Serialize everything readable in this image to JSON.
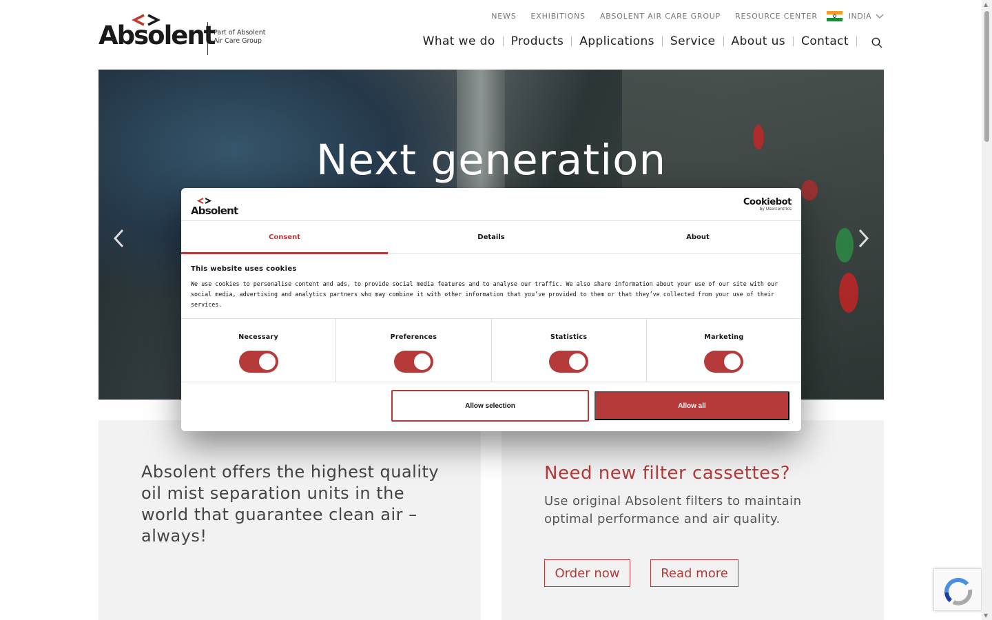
{
  "logo": {
    "word": "Absolent",
    "sub_line1": "Part of Absolent",
    "sub_line2": "Air Care Group"
  },
  "top_nav": {
    "items": [
      "NEWS",
      "EXHIBITIONS",
      "ABSOLENT AIR CARE GROUP",
      "RESOURCE CENTER"
    ],
    "country": "INDIA"
  },
  "main_nav": {
    "items": [
      "What we do",
      "Products",
      "Applications",
      "Service",
      "About us",
      "Contact"
    ]
  },
  "hero": {
    "title": "Next generation"
  },
  "cards": {
    "left_text": "Absolent offers the highest quality oil mist separation units in the world that guarantee clean air – always!",
    "right_title": "Need new filter cassettes?",
    "right_text": "Use original Absolent filters to maintain optimal performance and air quality.",
    "order_label": "Order now",
    "read_label": "Read more"
  },
  "cookie_dialog": {
    "logo_word": "Absolent",
    "provider": "Cookiebot",
    "provider_sub": "by Usercentrics",
    "tabs": [
      "Consent",
      "Details",
      "About"
    ],
    "heading": "This website uses cookies",
    "body": "We use cookies to personalise content and ads, to provide social media features and to analyse our traffic. We also share information about your use of our site with our social media, advertising and analytics partners who may combine it with other information that you’ve provided to them or that they’ve collected from your use of their services.",
    "toggles": [
      "Necessary",
      "Preferences",
      "Statistics",
      "Marketing"
    ],
    "allow_selection": "Allow selection",
    "allow_all": "Allow all"
  },
  "colors": {
    "brand_red": "#b73a3a",
    "card_bg": "#f2f2f2"
  }
}
